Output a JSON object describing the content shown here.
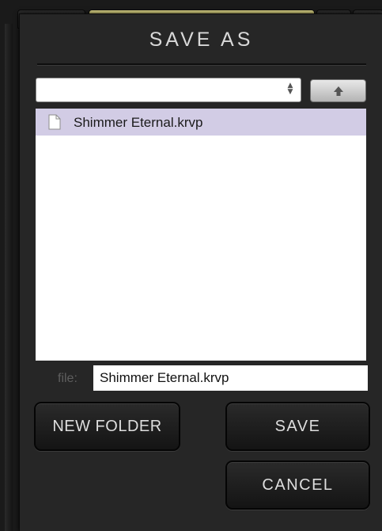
{
  "dialog": {
    "title": "SAVE AS"
  },
  "path_select": {
    "value": "",
    "arrows_icon": "updown-arrows-icon"
  },
  "up_button": {
    "icon": "up-arrow-icon"
  },
  "file_list": {
    "items": [
      {
        "label": "Shimmer Eternal.krvp",
        "icon": "document-icon",
        "selected": true
      }
    ]
  },
  "file_field": {
    "label": "file:",
    "value": "Shimmer Eternal.krvp"
  },
  "buttons": {
    "new_folder": "NEW FOLDER",
    "save": "SAVE",
    "cancel": "CANCEL"
  },
  "colors": {
    "dialog_bg": "#262626",
    "selection": "#d2cce5",
    "active_tab_accent": "#dcd68a"
  }
}
